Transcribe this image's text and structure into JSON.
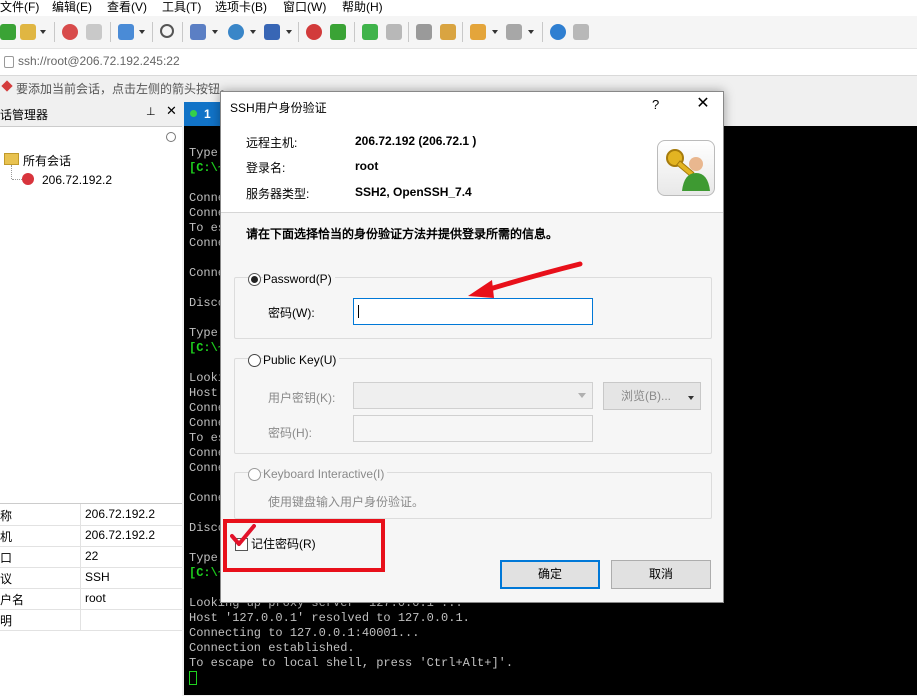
{
  "menubar": [
    "文件(F)",
    "编辑(E)",
    "查看(V)",
    "工具(T)",
    "选项卡(B)",
    "窗口(W)",
    "帮助(H)"
  ],
  "address": "ssh://root@206.72.192.245:22",
  "hint": "要添加当前会话，点击左侧的箭头按钮。",
  "session_manager": {
    "title": "话管理器",
    "root_label": "所有会话",
    "session_label": "206.72.192.2"
  },
  "properties": [
    {
      "key": "称",
      "value": "206.72.192.2"
    },
    {
      "key": "机",
      "value": "206.72.192.2"
    },
    {
      "key": "口",
      "value": "22"
    },
    {
      "key": "议",
      "value": "SSH"
    },
    {
      "key": "户名",
      "value": "root"
    },
    {
      "key": "明",
      "value": ""
    }
  ],
  "terminal": {
    "tab_label": "1",
    "lines": [
      {
        "t": "Type",
        "c": "n"
      },
      {
        "t": "[C:\\~",
        "c": "g"
      },
      {
        "t": "",
        "c": "n"
      },
      {
        "t": "Conne",
        "c": "n"
      },
      {
        "t": "Conne",
        "c": "n"
      },
      {
        "t": "To es",
        "c": "n"
      },
      {
        "t": "Conne",
        "c": "n"
      },
      {
        "t": "",
        "c": "n"
      },
      {
        "t": "Conne",
        "c": "n"
      },
      {
        "t": "",
        "c": "n"
      },
      {
        "t": "Disco",
        "c": "n"
      },
      {
        "t": "",
        "c": "n"
      },
      {
        "t": "Type",
        "c": "n"
      },
      {
        "t": "[C:\\~",
        "c": "g"
      },
      {
        "t": "",
        "c": "n"
      },
      {
        "t": "Looki",
        "c": "n"
      },
      {
        "t": "Host",
        "c": "n"
      },
      {
        "t": "Conne",
        "c": "n"
      },
      {
        "t": "Conne",
        "c": "n"
      },
      {
        "t": "To es",
        "c": "n"
      },
      {
        "t": "Conne",
        "c": "n"
      },
      {
        "t": "Conne",
        "c": "n"
      },
      {
        "t": "",
        "c": "n"
      },
      {
        "t": "Conne",
        "c": "n"
      },
      {
        "t": "",
        "c": "n"
      },
      {
        "t": "Disco",
        "c": "n"
      },
      {
        "t": "",
        "c": "n"
      },
      {
        "t": "Type",
        "c": "n"
      },
      {
        "t": "[C:\\~",
        "c": "g"
      },
      {
        "t": "",
        "c": "n"
      },
      {
        "t": "Looking up proxy server '127.0.0.1'...",
        "c": "n"
      },
      {
        "t": "Host '127.0.0.1' resolved to 127.0.0.1.",
        "c": "n"
      },
      {
        "t": "Connecting to 127.0.0.1:40001...",
        "c": "n"
      },
      {
        "t": "Connection established.",
        "c": "n"
      },
      {
        "t": "To escape to local shell, press 'Ctrl+Alt+]'.",
        "c": "n"
      }
    ]
  },
  "dialog": {
    "title": "SSH用户身份验证",
    "help": "?",
    "close": "✕",
    "remote_host_label": "远程主机:",
    "remote_host_value": "206.72.192 (206.72.1 )",
    "login_label": "登录名:",
    "login_value": "root",
    "server_type_label": "服务器类型:",
    "server_type_value": "SSH2, OpenSSH_7.4",
    "instruction": "请在下面选择恰当的身份验证方法并提供登录所需的信息。",
    "password_option": "Password(P)",
    "password_label": "密码(W):",
    "password_value": "",
    "pubkey_option": "Public Key(U)",
    "user_key_label": "用户密钥(K):",
    "browse_button": "浏览(B)...",
    "passphrase_label": "密码(H):",
    "kbd_option": "Keyboard Interactive(I)",
    "kbd_desc": "使用键盘输入用户身份验证。",
    "remember_label": "记住密码(R)",
    "ok_button": "确定",
    "cancel_button": "取消"
  },
  "colors": {
    "accent": "#0078d7",
    "annotation_red": "#e8101a",
    "terminal_green": "#1ed21e"
  }
}
